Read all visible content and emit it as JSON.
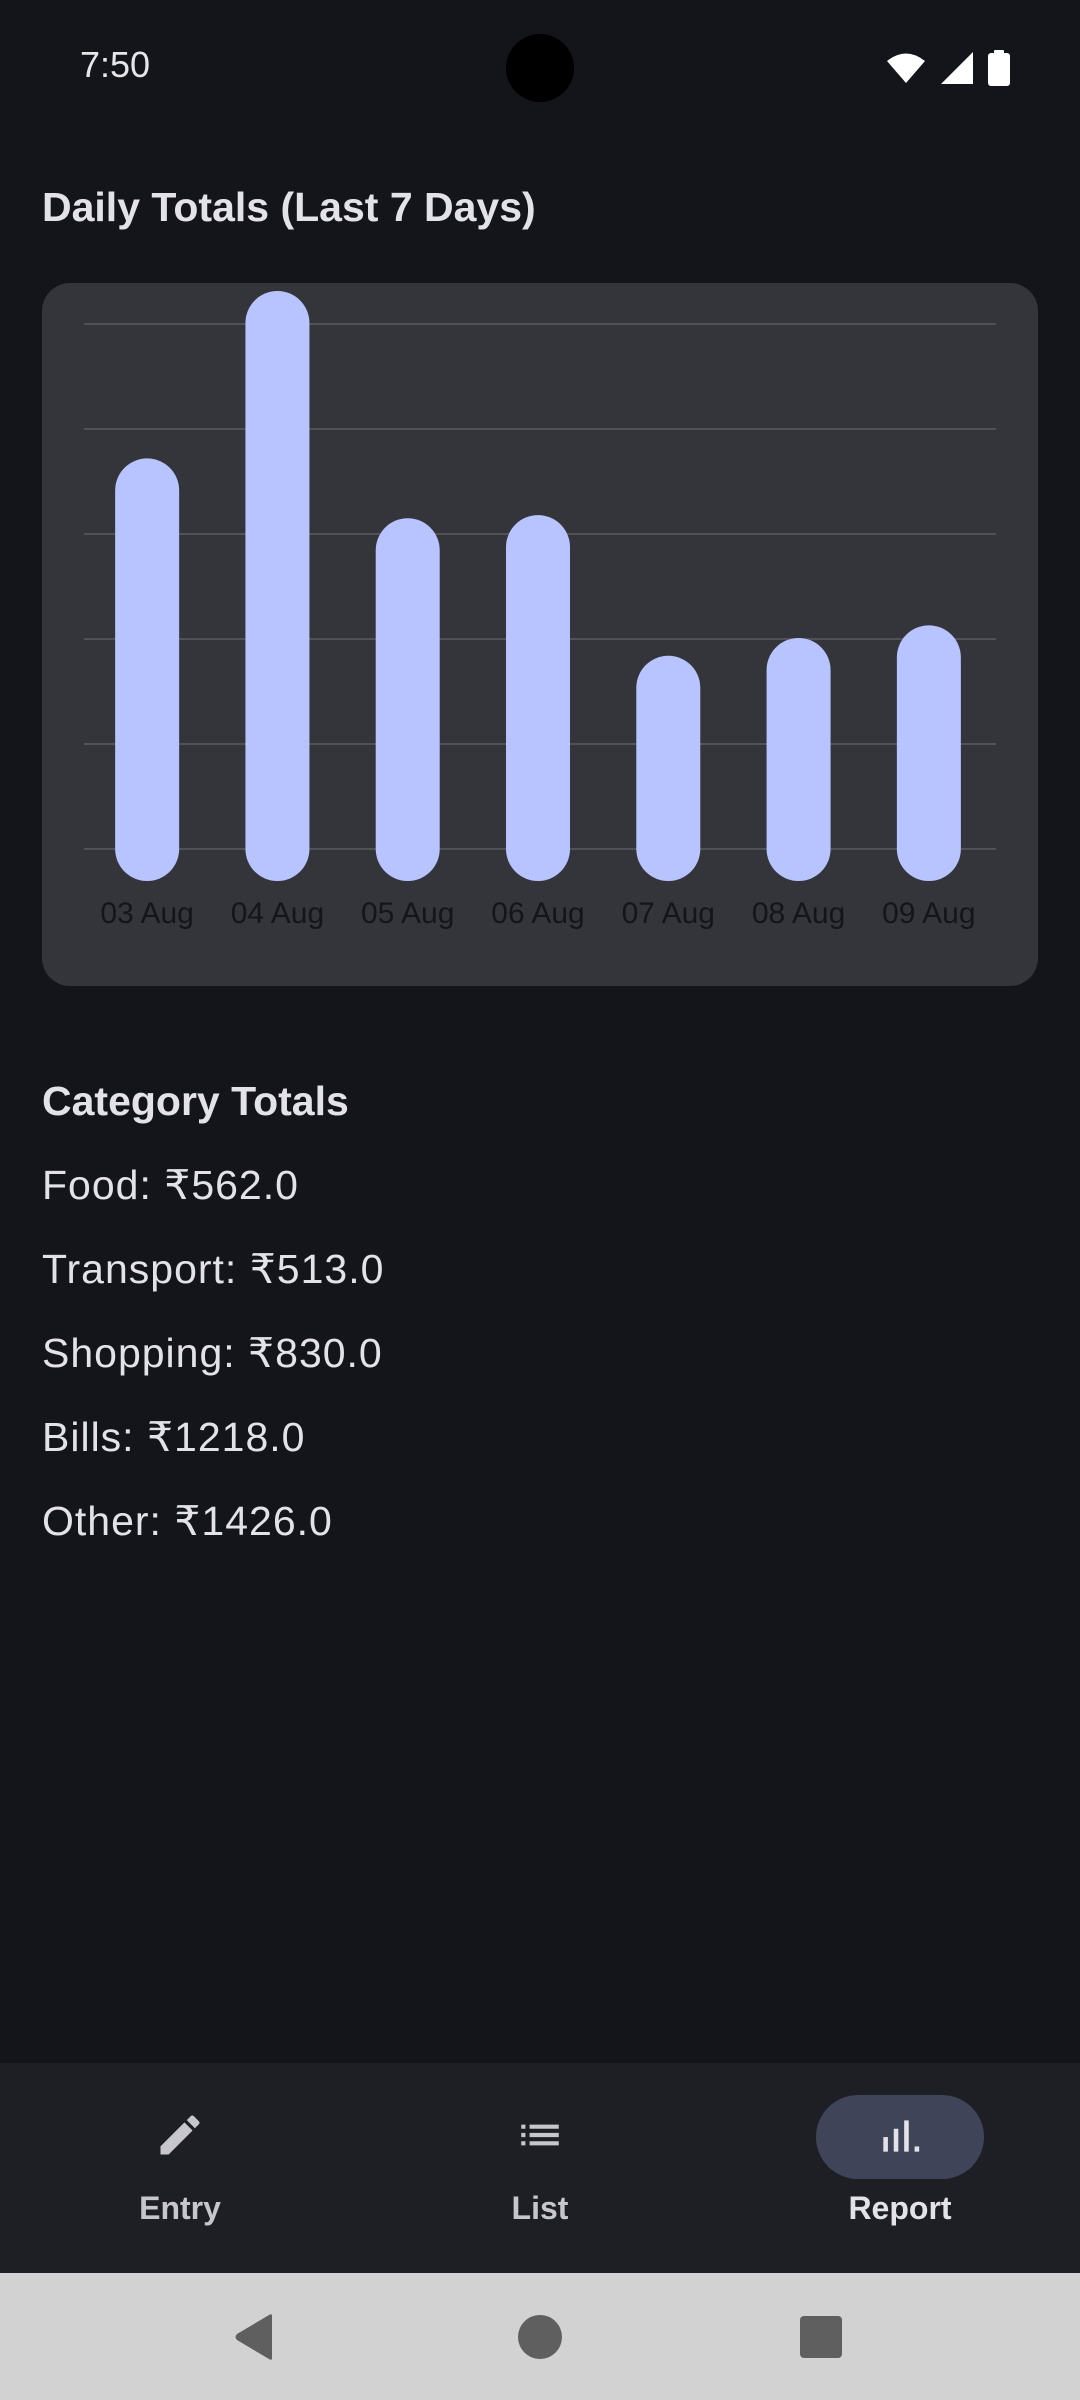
{
  "status_bar": {
    "time": "7:50",
    "icons": [
      "wifi-icon",
      "cellular-signal-icon",
      "battery-icon"
    ]
  },
  "daily_section": {
    "title": "Daily Totals (Last 7 Days)"
  },
  "chart_data": {
    "type": "bar",
    "categories": [
      "03 Aug",
      "04 Aug",
      "05 Aug",
      "06 Aug",
      "07 Aug",
      "08 Aug",
      "09 Aug"
    ],
    "values": [
      372,
      559,
      315,
      318,
      184,
      201,
      213
    ],
    "ylim": [
      0,
      500
    ],
    "grid": true,
    "bar_color": "#b8c4ff",
    "label_color": "#14151a",
    "grid_color": "#5b5c63"
  },
  "category_section": {
    "title": "Category Totals",
    "items": [
      "Food: ₹562.0",
      "Transport: ₹513.0",
      "Shopping: ₹830.0",
      "Bills: ₹1218.0",
      "Other: ₹1426.0"
    ]
  },
  "bottom_nav": {
    "items": [
      {
        "label": "Entry",
        "icon": "pencil-icon",
        "active": false
      },
      {
        "label": "List",
        "icon": "list-icon",
        "active": false
      },
      {
        "label": "Report",
        "icon": "bar-chart-icon",
        "active": true
      }
    ]
  },
  "system_nav": {
    "buttons": [
      "back-icon",
      "home-icon",
      "recents-icon"
    ]
  },
  "colors": {
    "background": "#14151a",
    "card": "#34353b",
    "accent": "#b8c4ff",
    "nav_background": "#1e1f25",
    "active_pill": "#3f4459",
    "system_nav_background": "#d2d2d2"
  }
}
